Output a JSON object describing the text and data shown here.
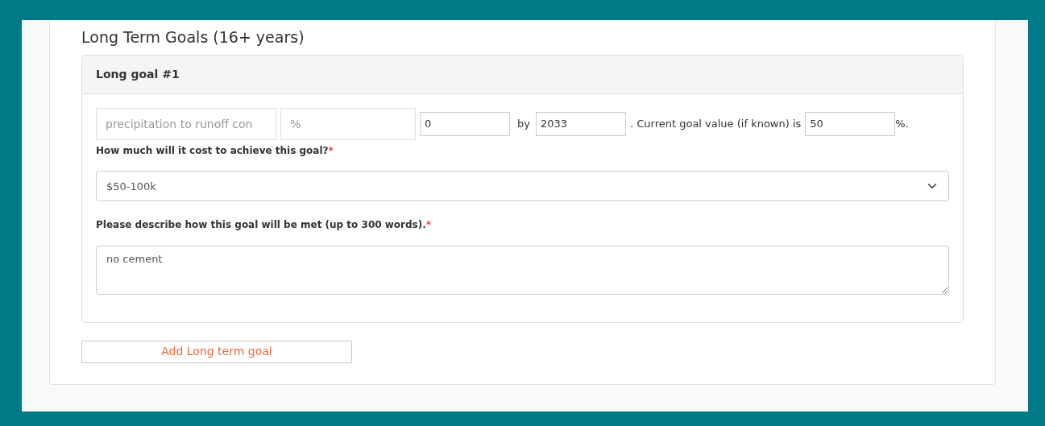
{
  "section_title": "Long Term Goals (16+ years)",
  "goals": [
    {
      "title": "Long goal #1",
      "metric": {
        "placeholder": "precipitation to runoff con"
      },
      "unit": {
        "placeholder": "%"
      },
      "target": {
        "value": "0"
      },
      "by_label": "by",
      "year": {
        "value": "2033"
      },
      "current_label": ". Current goal value (if known) is",
      "current": {
        "value": "50"
      },
      "suffix": "%.",
      "cost_label": "How much will it cost to achieve this goal?",
      "cost_required": "*",
      "cost": {
        "value": "$50-100k"
      },
      "describe_label": "Please describe how this goal will be met (up to 300 words).",
      "describe_required": "*",
      "describe": {
        "value": "no cement"
      }
    }
  ],
  "add_button": "Add Long term goal"
}
